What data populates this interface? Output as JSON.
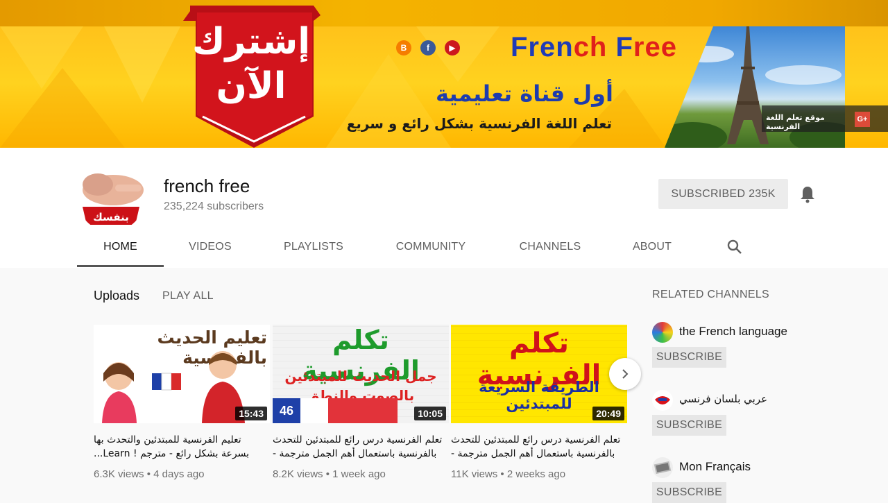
{
  "banner": {
    "ribbon_line1": "إشترك",
    "ribbon_line2": "الآن",
    "brand_part1": "Fren",
    "brand_part2": "ch ",
    "brand_part3": "F",
    "brand_part4": "ree",
    "tagline": "أول قناة تعليمية",
    "subtagline": "تعلم اللغة الفرنسية بشكل رائع و سريع",
    "gplus_link_text": "موقع تعلم اللغة الفرنسية",
    "gplus_label": "G+",
    "social_icons": [
      "blogger-icon",
      "facebook-icon",
      "youtube-icon"
    ]
  },
  "channel": {
    "name": "french free",
    "subscribers": "235,224 subscribers",
    "subscribed_label": "SUBSCRIBED  235K",
    "avatar_text": "بنفسك"
  },
  "tabs": [
    {
      "label": "HOME",
      "active": true
    },
    {
      "label": "VIDEOS"
    },
    {
      "label": "PLAYLISTS"
    },
    {
      "label": "COMMUNITY"
    },
    {
      "label": "CHANNELS"
    },
    {
      "label": "ABOUT"
    }
  ],
  "uploads": {
    "title": "Uploads",
    "play_all": "PLAY ALL",
    "videos": [
      {
        "thumb_text": "تعليم الحديث بالفرنسية",
        "duration": "15:43",
        "title_line1": "تعليم الفرنسية للمبتدئين والتحدث بها",
        "title_line2": "بسرعة بشكل رائع - مترجم ! Learn...",
        "views": "6.3K views",
        "age": "4 days ago"
      },
      {
        "thumb_text1": "تكلم الفرنسية",
        "thumb_text2": "جمل الحديث للمبتدئين",
        "thumb_text3": "بالصوت والنطق",
        "thumb_badge": "46",
        "duration": "10:05",
        "title_line1": "تعلم الفرنسية درس رائع للمبتدئين للتحدث",
        "title_line2": "بالفرنسية باستعمال أهم الجمل مترجمة - ...",
        "views": "8.2K views",
        "age": "1 week ago"
      },
      {
        "thumb_text1": "تكلم الفرنسية",
        "thumb_text2": "الطريقة السريعة للمبتدئين",
        "duration": "20:49",
        "title_line1": "تعلم الفرنسية درس رائع للمبتدئين للتحدث",
        "title_line2": "بالفرنسية باستعمال أهم الجمل مترجمة - ...",
        "views": "11K views",
        "age": "2 weeks ago"
      }
    ]
  },
  "related": {
    "title": "RELATED CHANNELS",
    "channels": [
      {
        "name": "the French language",
        "button": "SUBSCRIBE"
      },
      {
        "name": "عربي بلسان فرنسي",
        "button": "SUBSCRIBE"
      },
      {
        "name": "Mon Français",
        "button": "SUBSCRIBE"
      }
    ]
  },
  "colors": {
    "brand_blue": "#1f3bb8",
    "brand_red": "#e0201b",
    "ribbon_red": "#d2141c",
    "banner_yellow": "#ffc21a"
  }
}
